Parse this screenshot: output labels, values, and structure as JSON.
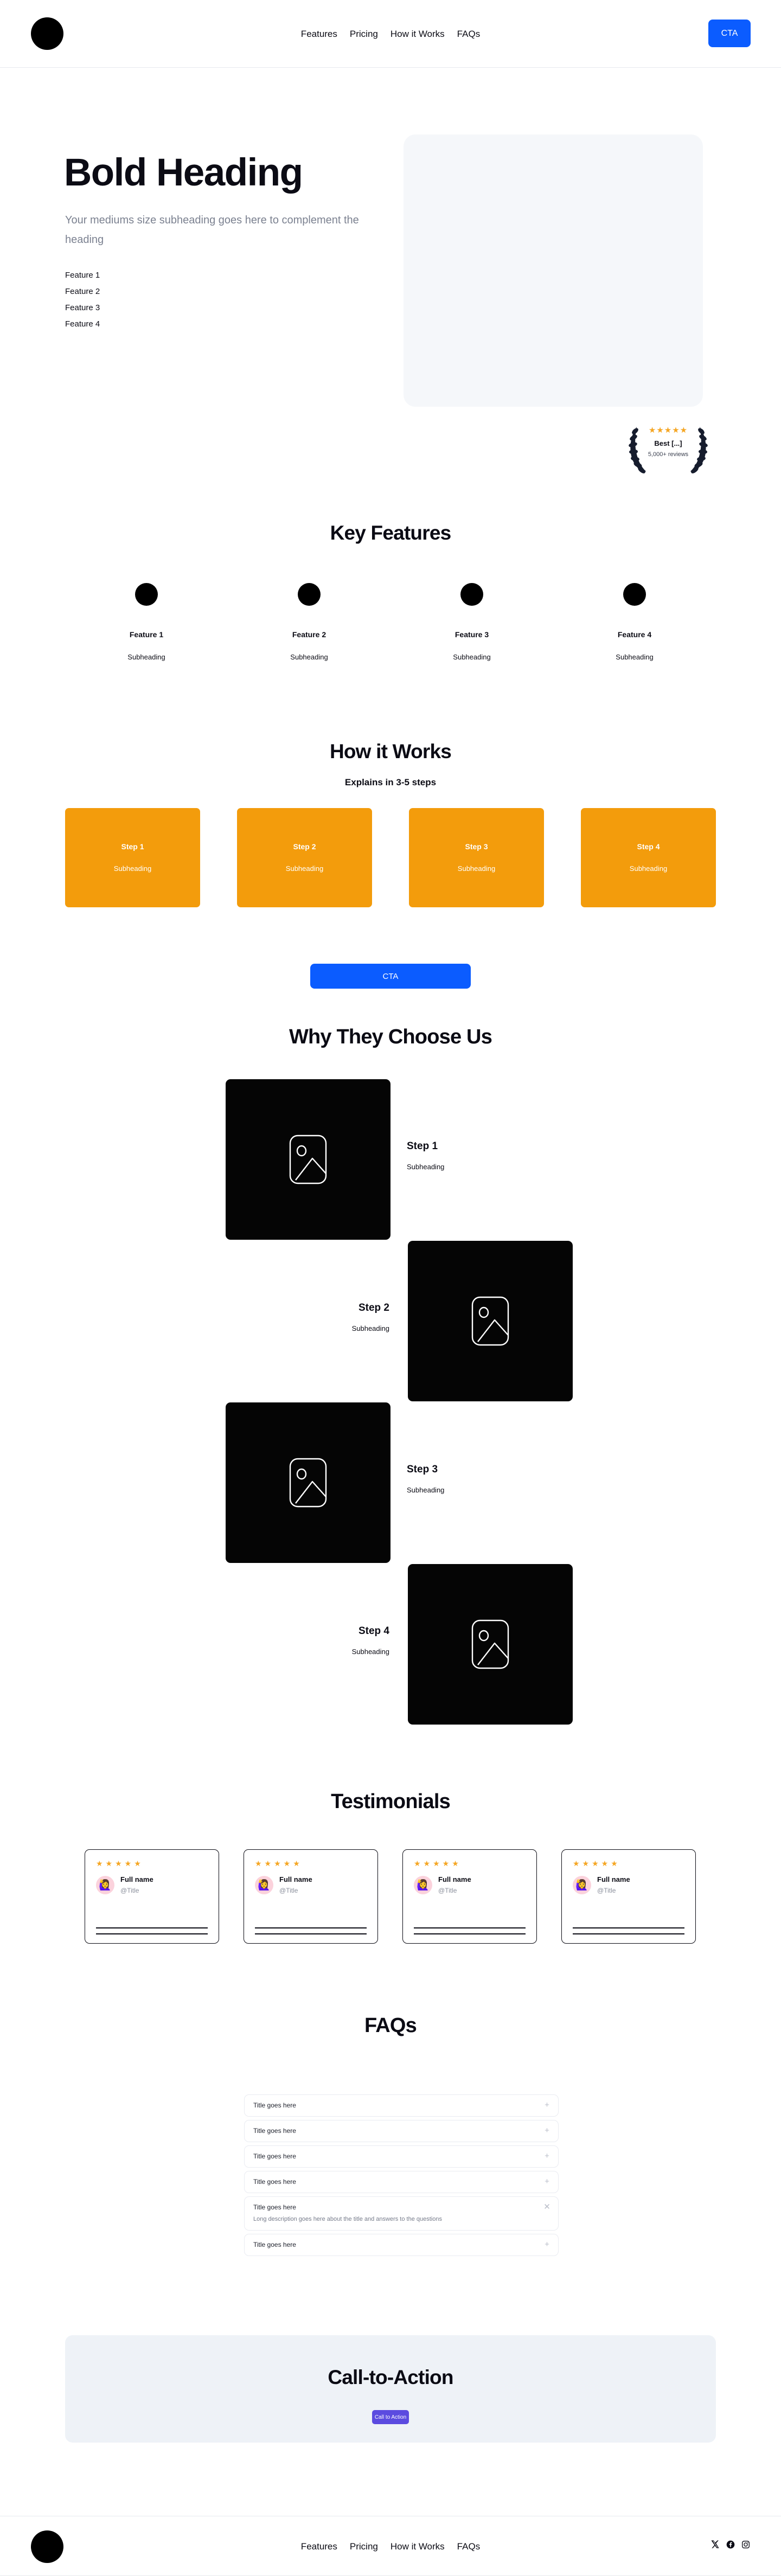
{
  "nav": {
    "logo_icon": "circle-logo-icon",
    "links": [
      "Features",
      "Pricing",
      "How it Works",
      "FAQs"
    ],
    "cta_label": "CTA",
    "cta_color": "#0b5cff"
  },
  "hero": {
    "title": "Bold Heading",
    "subheading": "Your mediums size subheading goes here to complement the heading",
    "features": [
      "Feature 1",
      "Feature 2",
      "Feature 3",
      "Feature 4"
    ],
    "media_placeholder_color": "#f5f7fa"
  },
  "badge": {
    "stars": "★★★★★",
    "star_color": "#f5a623",
    "title": "Best [...]",
    "reviews": "5,000+ reviews",
    "laurel_icon": "laurel-wreath-icon"
  },
  "key_features": {
    "title": "Key Features",
    "items": [
      {
        "name": "Feature 1",
        "sub": "Subheading",
        "icon": "circle-icon"
      },
      {
        "name": "Feature 2",
        "sub": "Subheading",
        "icon": "circle-icon"
      },
      {
        "name": "Feature 3",
        "sub": "Subheading",
        "icon": "circle-icon"
      },
      {
        "name": "Feature 4",
        "sub": "Subheading",
        "icon": "circle-icon"
      }
    ]
  },
  "how_it_works": {
    "title": "How it Works",
    "subtitle": "Explains in 3-5 steps",
    "card_color": "#f39c0c",
    "cards": [
      {
        "step": "Step 1",
        "sub": "Subheading"
      },
      {
        "step": "Step 2",
        "sub": "Subheading"
      },
      {
        "step": "Step 3",
        "sub": "Subheading"
      },
      {
        "step": "Step 4",
        "sub": "Subheading"
      }
    ],
    "cta_label": "CTA",
    "cta_color": "#0b5cff"
  },
  "why_choose": {
    "title": "Why They Choose Us",
    "image_icon": "image-placeholder-icon",
    "rows": [
      {
        "step": "Step 1",
        "sub": "Subheading",
        "align": "left"
      },
      {
        "step": "Step 2",
        "sub": "Subheading",
        "align": "right"
      },
      {
        "step": "Step 3",
        "sub": "Subheading",
        "align": "left"
      },
      {
        "step": "Step 4",
        "sub": "Subheading",
        "align": "right"
      }
    ]
  },
  "testimonials": {
    "title": "Testimonials",
    "star_color": "#f5a623",
    "cards": [
      {
        "stars": "★★★★★",
        "name": "Full name",
        "handle": "@Title",
        "avatar_icon": "avatar-icon"
      },
      {
        "stars": "★★★★★",
        "name": "Full name",
        "handle": "@Title",
        "avatar_icon": "avatar-icon"
      },
      {
        "stars": "★★★★★",
        "name": "Full name",
        "handle": "@Title",
        "avatar_icon": "avatar-icon"
      },
      {
        "stars": "★★★★★",
        "name": "Full name",
        "handle": "@Title",
        "avatar_icon": "avatar-icon"
      }
    ]
  },
  "faqs": {
    "title": "FAQs",
    "items": [
      {
        "question": "Title goes here",
        "answer": "",
        "expanded": false,
        "icon": "plus-icon"
      },
      {
        "question": "Title goes here",
        "answer": "",
        "expanded": false,
        "icon": "plus-icon"
      },
      {
        "question": "Title goes here",
        "answer": "",
        "expanded": false,
        "icon": "plus-icon"
      },
      {
        "question": "Title goes here",
        "answer": "",
        "expanded": false,
        "icon": "plus-icon"
      },
      {
        "question": "Title goes here",
        "answer": "Long description goes here about the title and answers to the questions",
        "expanded": true,
        "icon": "close-icon"
      },
      {
        "question": "Title goes here",
        "answer": "",
        "expanded": false,
        "icon": "plus-icon"
      }
    ]
  },
  "cta_band": {
    "title": "Call-to-Action",
    "button_label": "Call to Action",
    "button_color": "#5b4be0",
    "background_color": "#eef2f7"
  },
  "footer": {
    "logo_icon": "circle-logo-icon",
    "links": [
      "Features",
      "Pricing",
      "How it Works",
      "FAQs"
    ],
    "social": [
      "x-icon",
      "facebook-icon",
      "instagram-icon"
    ]
  }
}
